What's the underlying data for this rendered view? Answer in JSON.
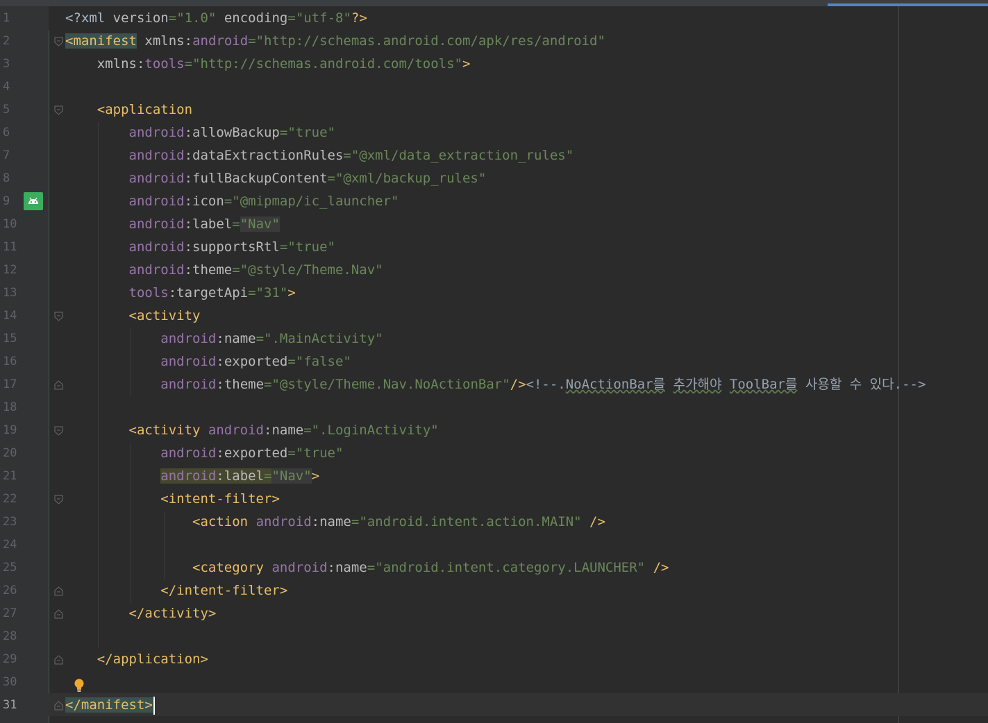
{
  "editor": {
    "line_numbers": [
      "1",
      "2",
      "3",
      "4",
      "5",
      "6",
      "7",
      "8",
      "9",
      "10",
      "11",
      "12",
      "13",
      "14",
      "15",
      "16",
      "17",
      "18",
      "19",
      "20",
      "21",
      "22",
      "23",
      "24",
      "25",
      "26",
      "27",
      "28",
      "29",
      "30",
      "31"
    ],
    "current_line": "31"
  },
  "code": {
    "l1": {
      "open": "<?xml",
      "sp1": " ",
      "a1": "version",
      "eq1": "=",
      "v1": "\"1.0\"",
      "sp2": " ",
      "a2": "encoding",
      "eq2": "=",
      "v2": "\"utf-8\"",
      "close": "?>"
    },
    "l2": {
      "tag": "<manifest",
      "sp": " ",
      "a1": "xmlns",
      "colon": ":",
      "ns": "android",
      "eq": "=",
      "v": "\"http://schemas.android.com/apk/res/android\""
    },
    "l3": {
      "indent": "    ",
      "a1": "xmlns",
      "colon": ":",
      "ns": "tools",
      "eq": "=",
      "v": "\"http://schemas.android.com/tools\"",
      "close": ">"
    },
    "l5": {
      "indent": "    ",
      "tag": "<application"
    },
    "l6": {
      "indent": "        ",
      "ns": "android",
      "colon": ":",
      "a": "allowBackup",
      "eq": "=",
      "v": "\"true\""
    },
    "l7": {
      "indent": "        ",
      "ns": "android",
      "colon": ":",
      "a": "dataExtractionRules",
      "eq": "=",
      "v": "\"@xml/data_extraction_rules\""
    },
    "l8": {
      "indent": "        ",
      "ns": "android",
      "colon": ":",
      "a": "fullBackupContent",
      "eq": "=",
      "v": "\"@xml/backup_rules\""
    },
    "l9": {
      "indent": "        ",
      "ns": "android",
      "colon": ":",
      "a": "icon",
      "eq": "=",
      "v": "\"@mipmap/ic_launcher\""
    },
    "l10": {
      "indent": "        ",
      "ns": "android",
      "colon": ":",
      "a": "label",
      "eq": "=",
      "v": "\"Nav\""
    },
    "l11": {
      "indent": "        ",
      "ns": "android",
      "colon": ":",
      "a": "supportsRtl",
      "eq": "=",
      "v": "\"true\""
    },
    "l12": {
      "indent": "        ",
      "ns": "android",
      "colon": ":",
      "a": "theme",
      "eq": "=",
      "v": "\"@style/Theme.Nav\""
    },
    "l13": {
      "indent": "        ",
      "ns": "tools",
      "colon": ":",
      "a": "targetApi",
      "eq": "=",
      "v": "\"31\"",
      "close": ">"
    },
    "l14": {
      "indent": "        ",
      "tag": "<activity"
    },
    "l15": {
      "indent": "            ",
      "ns": "android",
      "colon": ":",
      "a": "name",
      "eq": "=",
      "v": "\".MainActivity\""
    },
    "l16": {
      "indent": "            ",
      "ns": "android",
      "colon": ":",
      "a": "exported",
      "eq": "=",
      "v": "\"false\""
    },
    "l17": {
      "indent": "            ",
      "ns": "android",
      "colon": ":",
      "a": "theme",
      "eq": "=",
      "v": "\"@style/Theme.Nav.NoActionBar\"",
      "close": "/>",
      "c1": "<!--.",
      "c2": "NoActionBar를",
      "c3": " ",
      "c4": "추가해야",
      "c5": " ",
      "c6": "ToolBar를",
      "c7": " 사용할 수 있다.-->"
    },
    "l19": {
      "indent": "        ",
      "tag": "<activity",
      "sp": " ",
      "ns": "android",
      "colon": ":",
      "a": "name",
      "eq": "=",
      "v": "\".LoginActivity\""
    },
    "l20": {
      "indent": "            ",
      "ns": "android",
      "colon": ":",
      "a": "exported",
      "eq": "=",
      "v": "\"true\""
    },
    "l21": {
      "indent": "            ",
      "ns": "android",
      "colon": ":",
      "a": "label",
      "eq": "=",
      "v": "\"Nav\"",
      "close": ">"
    },
    "l22": {
      "indent": "            ",
      "tag": "<intent-filter",
      "close": ">"
    },
    "l23": {
      "indent": "                ",
      "tag": "<action",
      "sp": " ",
      "ns": "android",
      "colon": ":",
      "a": "name",
      "eq": "=",
      "v": "\"android.intent.action.MAIN\"",
      "close": " />"
    },
    "l25": {
      "indent": "                ",
      "tag": "<category",
      "sp": " ",
      "ns": "android",
      "colon": ":",
      "a": "name",
      "eq": "=",
      "v": "\"android.intent.category.LAUNCHER\"",
      "close": " />"
    },
    "l26": {
      "indent": "            ",
      "tag": "</intent-filter>"
    },
    "l27": {
      "indent": "        ",
      "tag": "</activity>"
    },
    "l29": {
      "indent": "    ",
      "tag": "</application>"
    },
    "l31": {
      "tag": "</manifest",
      "close": ">"
    }
  },
  "colors": {
    "background": "#2b2b2b",
    "gutter": "#313335",
    "tag": "#e8bf6a",
    "namespace": "#9876aa",
    "value": "#6a8759",
    "attribute": "#bababa",
    "accent": "#4a88c7"
  }
}
